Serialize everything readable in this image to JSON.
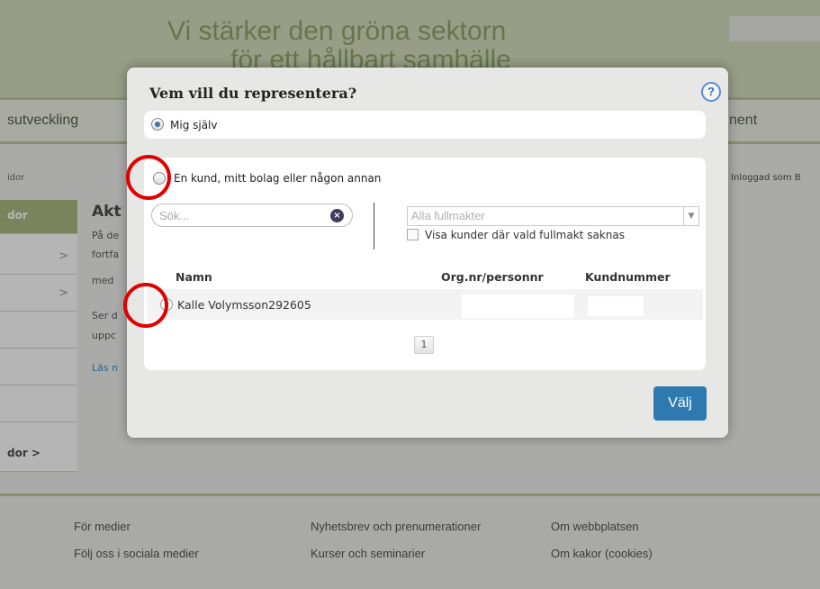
{
  "background": {
    "slogan_line1": "Vi stärker den gröna sektorn",
    "slogan_line2": "för ett hållbart samhälle",
    "nav_left": "sutveckling",
    "nav_right": "nent",
    "breadcrumb": "idor",
    "logged_in": "Inloggad som B",
    "sidebar": [
      {
        "label": "dor",
        "active": true
      },
      {
        "label": ">",
        "active": false
      },
      {
        "label": ">",
        "active": false
      },
      {
        "label": "",
        "active": false
      },
      {
        "label": "",
        "active": false
      },
      {
        "label": "",
        "active": false
      },
      {
        "label": "dor  >",
        "active": false
      }
    ],
    "main_title": "Akt",
    "main_lines": [
      "På de",
      "fortfa",
      "med",
      "Ser d",
      " uppc"
    ],
    "main_link": "Läs n",
    "footer": {
      "links": [
        "För medier",
        "Följ oss i sociala medier",
        "Nyhetsbrev och prenumerationer",
        "Kurser och seminarier",
        "Om webbplatsen",
        "Om kakor (cookies)"
      ]
    }
  },
  "modal": {
    "title": "Vem vill du representera?",
    "help_icon": "?",
    "option_self": {
      "label": "Mig själv",
      "checked": true
    },
    "option_other": {
      "label": "En kund, mitt bolag eller någon annan",
      "checked": false
    },
    "search": {
      "placeholder": "Sök..."
    },
    "filter": {
      "selected": "Alla fullmakter"
    },
    "checkbox_label": "Visa kunder där vald fullmakt saknas",
    "table": {
      "headers": [
        "Namn",
        "Org.nr/personnr",
        "Kundnummer"
      ],
      "rows": [
        {
          "name": "Kalle Volymsson292605",
          "orgnr": "",
          "kundnummer": ""
        }
      ]
    },
    "pager": {
      "current_page": "1"
    },
    "choose_button": "Välj"
  },
  "colors": {
    "accent_green": "#9fb170",
    "button_blue": "#2e7ab0",
    "annotation_red": "#e10000"
  }
}
